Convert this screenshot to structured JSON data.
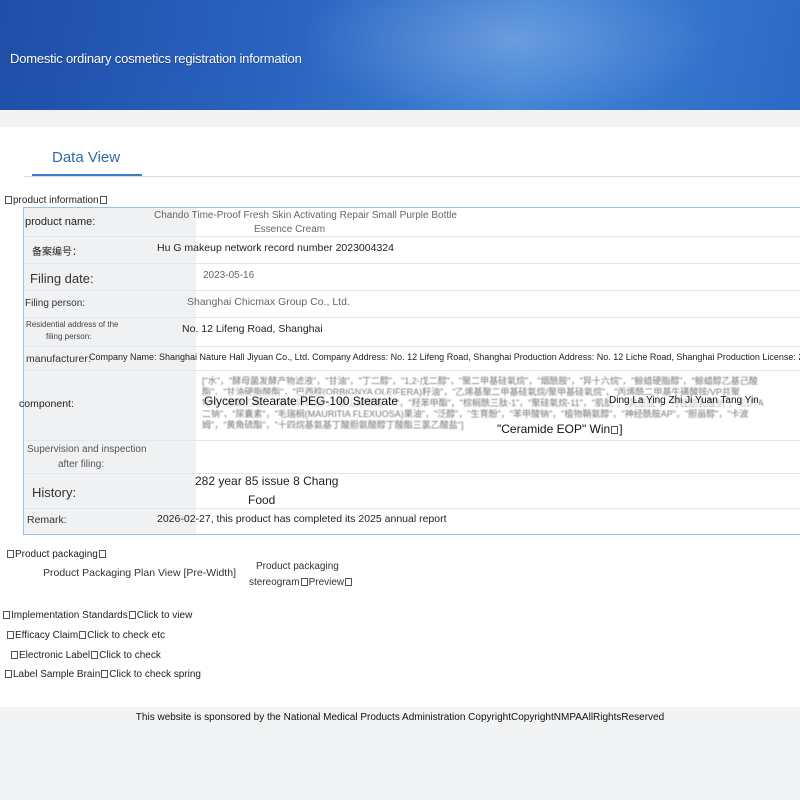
{
  "header": {
    "title": "Domestic ordinary cosmetics registration information"
  },
  "tab": {
    "label": "Data View"
  },
  "sections": {
    "product_info": "product information",
    "packaging": "Product packaging"
  },
  "details": {
    "product_name": {
      "label": "product name:",
      "value": "Chando Time-Proof Fresh Skin Activating Repair Small Purple Bottle",
      "value2": "Essence Cream"
    },
    "record_no": {
      "label": "备案编号：",
      "value": "Hu G makeup network record number 2023004324"
    },
    "filing_date": {
      "label": "Filing date:",
      "value": "2023-05-16"
    },
    "filing_person": {
      "label": "Filing person:",
      "value": "Shanghai Chicmax Group Co., Ltd."
    },
    "address": {
      "label": "Residential address of the",
      "label2": "filing person:",
      "value": "No. 12 Lifeng Road, Shanghai"
    },
    "manufacturer": {
      "label": "manufacturer:",
      "value": "Company Name: Shanghai Nature Hall Jiyuan Co., Ltd. Company Address: No. 12 Lifeng Road, Shanghai Production Address: No. 12 Liche Road, Shanghai Production License: 20160003"
    },
    "component": {
      "label": "component:",
      "blur_text": "[\"水\"，\"酵母菌发酵产物滤液\"，\"甘油\"，\"丁二醇\"，\"1,2-戊二醇\"，\"聚二甲基硅氧烷\"，\"烟酰胺\"，\"异十六烷\"，\"鲸蜡硬脂醇\"，\"鲸蜡醇乙基己酸酯\"，\"甘油硬脂酸酯\"，\"巴西棕(ORBIGNYA OLEIFERA)籽油\"，\"乙烯基聚二甲基硅氧烷/聚甲基硅氧烷\"，\"丙烯酰二甲基牛磺酸铵/VP共聚物\"，\"苯氧乙醇\"，\"氢化卵磷脂\"，\"聚山梨醇酯-60\"，\"羟苯甲酯\"，\"棕榈酰三肽-1\"，\"聚硅氧烷-11\"，\"肌肽\"，\"黄原胶\"，\"月桂酰乳酸钠\"，\"EDTA二钠\"，\"尿囊素\"，\"毛瑞榈(MAURITIA FLEXUOSA)果油\"，\"泛醇\"，\"生育酚\"，\"苯甲酸钠\"，\"植物鞘氨醇\"，\"神经酰胺AP\"，\"胆甾醇\"，\"卡波姆\"，\"黄角硫酯\"，\"十四烷基氨基丁酸胆氨酸醇丁酸酯三氯乙酸盐\"]",
      "overlay1": "Glycerol Stearate PEG-100 Stearate",
      "overlay2": "Ding La Ying Zhi Ji Yuan Tang Yin",
      "overlay3": "\"Ceramide EOP\" Win",
      "overlay3_end": "]"
    },
    "supervision": {
      "label": "Supervision and inspection",
      "label2": "after filing:",
      "value": ""
    },
    "history": {
      "label": "History:",
      "value": "282 year 85 issue 8 Chang",
      "value2": "Food"
    },
    "remark": {
      "label": "Remark:",
      "value": "2026-02-27, this product has completed its 2025 annual report"
    }
  },
  "packaging": {
    "plan_view": "Product Packaging Plan View [Pre-Width]",
    "stereogram1": "Product packaging",
    "stereogram2": "stereogram",
    "preview": "Preview"
  },
  "links": [
    {
      "label": "Implementation Standards",
      "action": "Click to view"
    },
    {
      "label": "Efficacy Claim",
      "action": "Click to check etc"
    },
    {
      "label": "Electronic Label",
      "action": "Click to check"
    },
    {
      "label": "Label Sample Brain",
      "action": "Click to check spring"
    }
  ],
  "footer": {
    "text": "This website is sponsored by the National Medical Products Administration CopyrightCopyrightNMPAAllRightsReserved"
  }
}
